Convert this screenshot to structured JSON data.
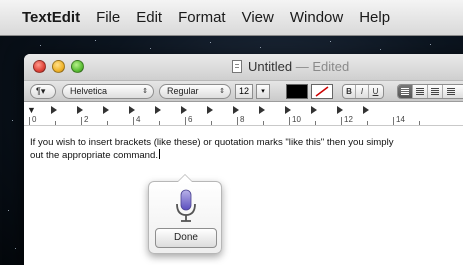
{
  "menubar": {
    "app_name": "TextEdit",
    "items": [
      "File",
      "Edit",
      "Format",
      "View",
      "Window",
      "Help"
    ]
  },
  "window": {
    "title": "Untitled",
    "title_status": "— Edited"
  },
  "toolbar": {
    "paragraph_style": "¶▾",
    "font_family": "Helvetica",
    "font_style": "Regular",
    "font_size": "12",
    "size_arrow": "▾",
    "bold": "B",
    "italic": "I",
    "underline": "U",
    "text_color": "#000000",
    "background_color": "#ffffff"
  },
  "ruler": {
    "labels": [
      "0",
      "2",
      "4",
      "6",
      "8",
      "10",
      "12",
      "14"
    ]
  },
  "document": {
    "line1": "If you wish to insert brackets (like these) or quotation marks \"like this\" then you simply",
    "line2": "out the appropriate command."
  },
  "dictation": {
    "done_label": "Done",
    "icon": "microphone-icon",
    "accent": "#6c5fc7"
  }
}
